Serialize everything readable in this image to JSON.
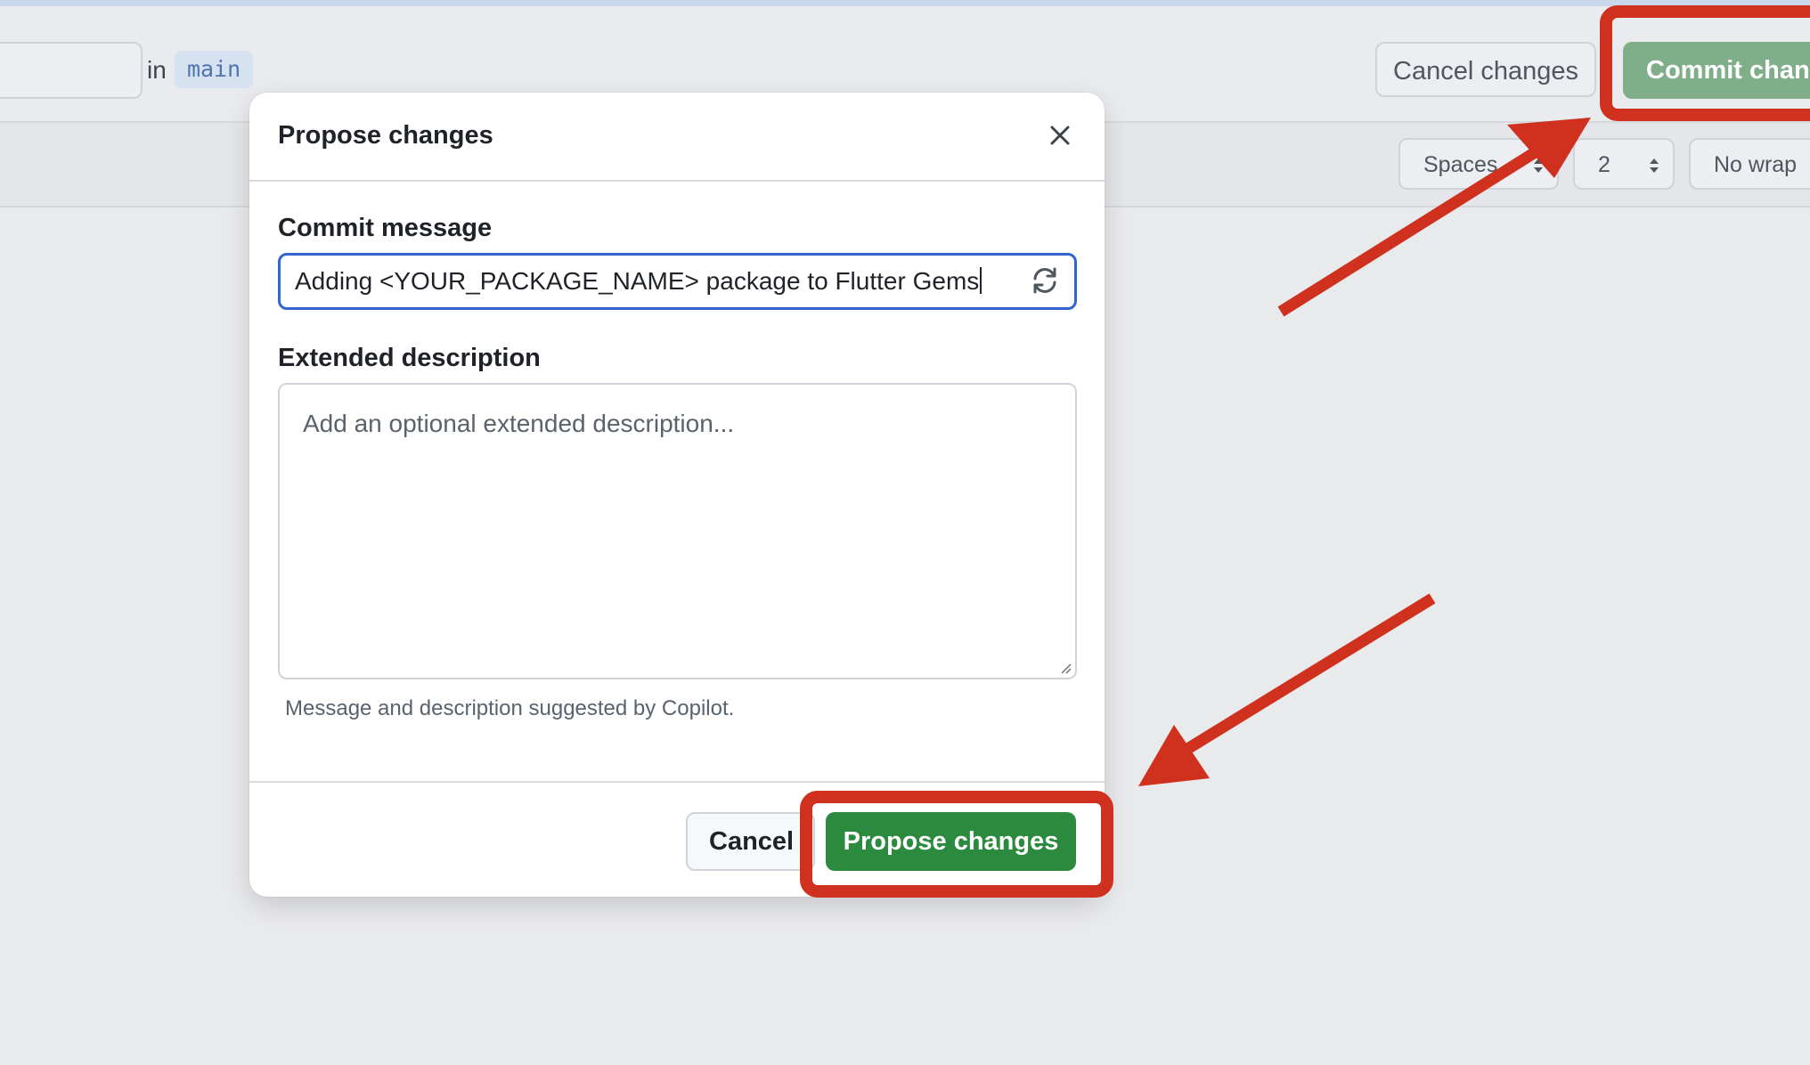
{
  "toolbar": {
    "in_label": "in",
    "branch": "main",
    "cancel_changes_label": "Cancel changes",
    "commit_changes_label": "Commit chang"
  },
  "editor_options": {
    "indent_mode": "Spaces",
    "indent_size": "2",
    "wrap_mode": "No wrap"
  },
  "modal": {
    "title": "Propose changes",
    "commit_message_label": "Commit message",
    "commit_message_value": "Adding <YOUR_PACKAGE_NAME> package to Flutter Gems",
    "extended_description_label": "Extended description",
    "extended_description_placeholder": "Add an optional extended description...",
    "copilot_note": "Message and description suggested by Copilot.",
    "cancel_label": "Cancel",
    "propose_label": "Propose changes"
  },
  "colors": {
    "annotation_red": "#d0301e",
    "primary_green": "#2c8a3e",
    "focus_blue": "#2f66d0"
  },
  "icons": {
    "close": "close-icon",
    "refresh": "refresh-icon",
    "select_arrows": "chevron-updown-icon",
    "resize": "resize-grip-icon"
  }
}
